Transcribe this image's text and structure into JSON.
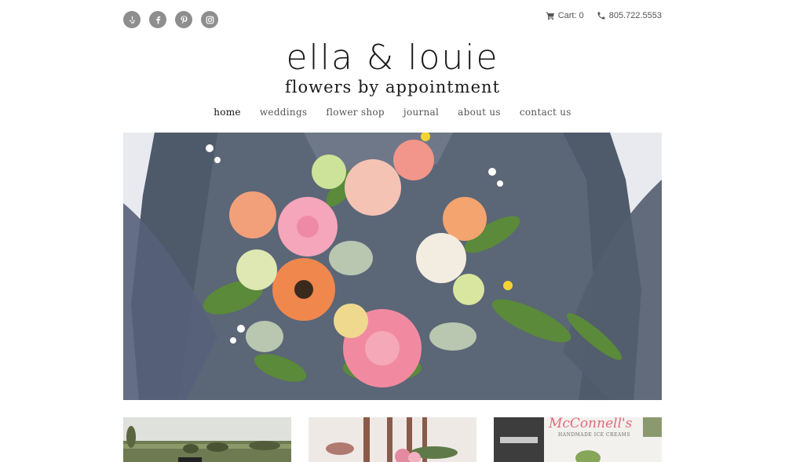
{
  "social": [
    {
      "icon": "yelp-icon",
      "label": "Yelp"
    },
    {
      "icon": "facebook-icon",
      "label": "Facebook"
    },
    {
      "icon": "pinterest-icon",
      "label": "Pinterest"
    },
    {
      "icon": "instagram-icon",
      "label": "Instagram"
    }
  ],
  "header": {
    "cart_label": "Cart: 0",
    "phone": "805.722.5553",
    "icon_color": "#8e8e8e"
  },
  "logo": {
    "title": "ella & louie",
    "subtitle": "flowers by appointment"
  },
  "nav": {
    "items": [
      {
        "label": "home",
        "active": true
      },
      {
        "label": "weddings",
        "active": false
      },
      {
        "label": "flower shop",
        "active": false
      },
      {
        "label": "journal",
        "active": false
      },
      {
        "label": "about us",
        "active": false
      },
      {
        "label": "contact us",
        "active": false
      }
    ]
  },
  "tiles": {
    "third_sign": "McConnell's",
    "third_sign_sub": "HANDMADE ICE CREAMS"
  }
}
